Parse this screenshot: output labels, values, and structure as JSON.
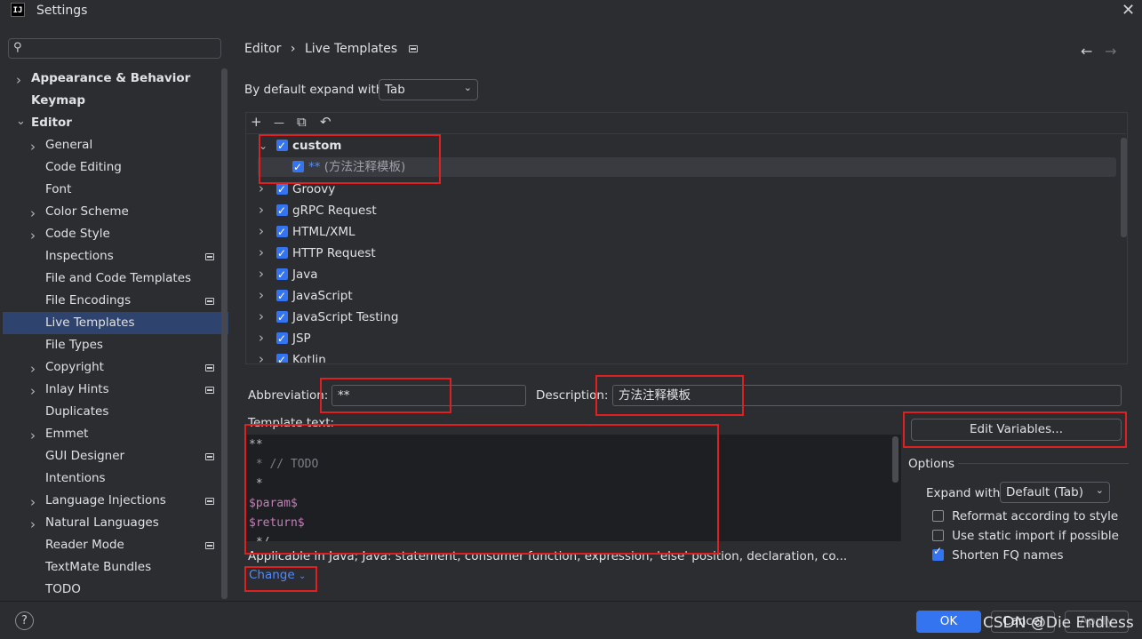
{
  "window": {
    "title": "Settings",
    "app_icon_text": "IJ"
  },
  "search": {
    "placeholder": ""
  },
  "sidebar": {
    "items": [
      {
        "label": "Appearance & Behavior",
        "expandable": true,
        "bold": true
      },
      {
        "label": "Keymap",
        "bold": true
      },
      {
        "label": "Editor",
        "expanded": true,
        "bold": true
      },
      {
        "label": "General",
        "expandable": true
      },
      {
        "label": "Code Editing"
      },
      {
        "label": "Font"
      },
      {
        "label": "Color Scheme",
        "expandable": true
      },
      {
        "label": "Code Style",
        "expandable": true
      },
      {
        "label": "Inspections",
        "project_icon": true
      },
      {
        "label": "File and Code Templates"
      },
      {
        "label": "File Encodings",
        "project_icon": true
      },
      {
        "label": "Live Templates",
        "selected": true
      },
      {
        "label": "File Types"
      },
      {
        "label": "Copyright",
        "expandable": true,
        "project_icon": true
      },
      {
        "label": "Inlay Hints",
        "expandable": true,
        "project_icon": true
      },
      {
        "label": "Duplicates"
      },
      {
        "label": "Emmet",
        "expandable": true
      },
      {
        "label": "GUI Designer",
        "project_icon": true
      },
      {
        "label": "Intentions"
      },
      {
        "label": "Language Injections",
        "expandable": true,
        "project_icon": true
      },
      {
        "label": "Natural Languages",
        "expandable": true
      },
      {
        "label": "Reader Mode",
        "project_icon": true
      },
      {
        "label": "TextMate Bundles"
      },
      {
        "label": "TODO"
      }
    ]
  },
  "breadcrumb": {
    "parent": "Editor",
    "sep": "›",
    "current": "Live Templates"
  },
  "expand": {
    "label": "By default expand with",
    "value": "Tab"
  },
  "toolbar": {
    "add": "+",
    "remove": "—",
    "copy": "⧉",
    "restore": "↶"
  },
  "templates": [
    {
      "name": "custom",
      "expanded": true,
      "bold": true,
      "checked": true
    },
    {
      "name": "** (方法注释模板)",
      "child": true,
      "checked": true,
      "selected": true
    },
    {
      "name": "Groovy",
      "checked": true
    },
    {
      "name": "gRPC Request",
      "checked": true
    },
    {
      "name": "HTML/XML",
      "checked": true
    },
    {
      "name": "HTTP Request",
      "checked": true
    },
    {
      "name": "Java",
      "checked": true
    },
    {
      "name": "JavaScript",
      "checked": true
    },
    {
      "name": "JavaScript Testing",
      "checked": true
    },
    {
      "name": "JSP",
      "checked": true
    },
    {
      "name": "Kotlin",
      "checked": true
    }
  ],
  "abbreviation": {
    "label": "Abbreviation:",
    "value": "**"
  },
  "description": {
    "label": "Description:",
    "value": "方法注释模板"
  },
  "template_text": {
    "label": "Template text:",
    "lines": [
      "**",
      " * // TODO",
      " *",
      "$param$",
      "$return$",
      " */"
    ]
  },
  "edit_variables": {
    "label": "Edit Variables..."
  },
  "options": {
    "title": "Options",
    "expand_with_label": "Expand with",
    "expand_with_value": "Default (Tab)",
    "reformat": {
      "label": "Reformat according to style",
      "checked": false
    },
    "static_import": {
      "label": "Use static import if possible",
      "checked": false
    },
    "shorten_fq": {
      "label": "Shorten FQ names",
      "checked": true
    }
  },
  "applicable": {
    "text": "Applicable in Java; Java: statement, consumer function, expression, 'else' position, declaration, co...",
    "change_label": "Change"
  },
  "footer": {
    "ok": "OK",
    "cancel": "Cancel",
    "apply": "Apply",
    "help": "?"
  },
  "watermark": "CSDN @Die  Endless",
  "colors": {
    "accent": "#3574f0",
    "selection": "#2e436e",
    "annotation_box": "#e02020"
  }
}
